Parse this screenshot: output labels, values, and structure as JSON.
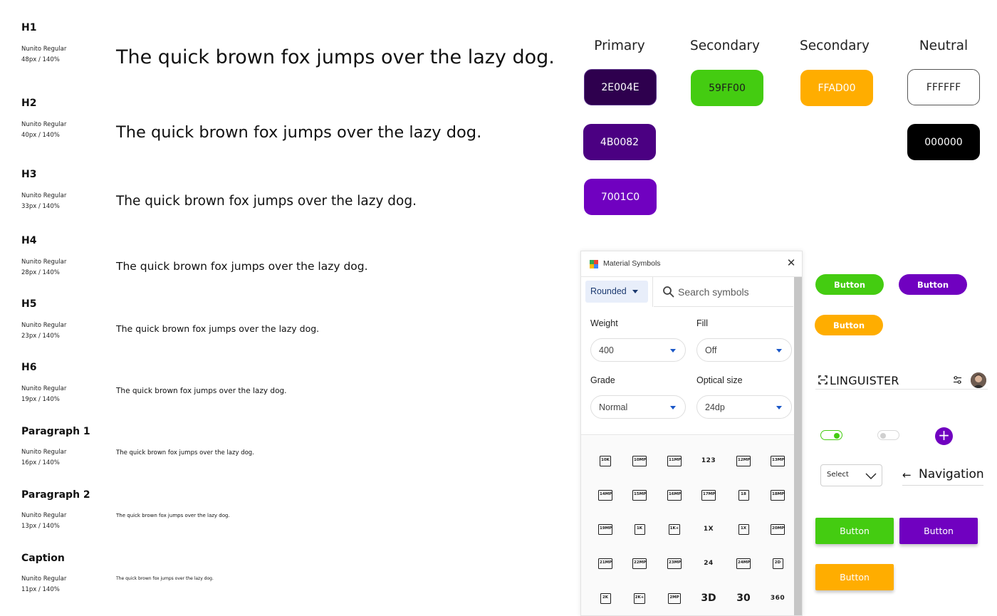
{
  "typography": {
    "sample_text": "The quick brown fox jumps over the lazy dog.",
    "styles": [
      {
        "name": "H1",
        "font": "Nunito Regular",
        "spec": "48px / 140%"
      },
      {
        "name": "H2",
        "font": "Nunito Regular",
        "spec": "40px / 140%"
      },
      {
        "name": "H3",
        "font": "Nunito Regular",
        "spec": "33px / 140%"
      },
      {
        "name": "H4",
        "font": "Nunito Regular",
        "spec": "28px / 140%"
      },
      {
        "name": "H5",
        "font": "Nunito Regular",
        "spec": "23px / 140%"
      },
      {
        "name": "H6",
        "font": "Nunito Regular",
        "spec": "19px / 140%"
      },
      {
        "name": "Paragraph 1",
        "font": "Nunito Regular",
        "spec": "16px / 140%"
      },
      {
        "name": "Paragraph 2",
        "font": "Nunito Regular",
        "spec": "13px / 140%"
      },
      {
        "name": "Caption",
        "font": "Nunito Regular",
        "spec": "11px / 140%"
      }
    ]
  },
  "palette": {
    "headers": [
      "Primary",
      "Secondary",
      "Secondary",
      "Neutral"
    ],
    "primary": [
      {
        "label": "2E004E",
        "color": "#2E004E"
      },
      {
        "label": "4B0082",
        "color": "#4B0082"
      },
      {
        "label": "7001C0",
        "color": "#7001C0"
      }
    ],
    "secondary_green": {
      "label": "59FF00",
      "color": "#59FF00"
    },
    "secondary_orange": {
      "label": "FFAD00",
      "color": "#FFAD00"
    },
    "neutral": [
      {
        "label": "FFFFFF",
        "color": "#FFFFFF"
      },
      {
        "label": "000000",
        "color": "#000000"
      }
    ]
  },
  "material_symbols": {
    "title": "Material Symbols",
    "style": "Rounded",
    "search_placeholder": "Search symbols",
    "weight": {
      "label": "Weight",
      "value": "400"
    },
    "fill": {
      "label": "Fill",
      "value": "Off"
    },
    "grade": {
      "label": "Grade",
      "value": "Normal"
    },
    "optical_size": {
      "label": "Optical size",
      "value": "24dp"
    },
    "glyphs": [
      [
        "10K",
        "10MP",
        "11MP",
        "123",
        "12MP",
        "13MP"
      ],
      [
        "14MP",
        "15MP",
        "16MP",
        "17MP",
        "18",
        "18MP"
      ],
      [
        "19MP",
        "1K",
        "1K+",
        "1X",
        "1X",
        "20MP"
      ],
      [
        "21MP",
        "22MP",
        "23MP",
        "24",
        "24MP",
        "2D"
      ],
      [
        "2K",
        "2K+",
        "2MP",
        "3D",
        "30",
        "360"
      ]
    ]
  },
  "components": {
    "pill_buttons": [
      {
        "label": "Button",
        "color": "#44CC11"
      },
      {
        "label": "Button",
        "color": "#7001C0"
      },
      {
        "label": "Button",
        "color": "#FFAD00"
      }
    ],
    "app_bar_title": "LINGUISTER",
    "toggle_on_color": "#44CC11",
    "select_label": "Select",
    "navigation_label": "Navigation",
    "navigation_arrow": "←",
    "fab_symbol": "+",
    "rect_buttons": [
      {
        "label": "Button",
        "color": "#44CC11"
      },
      {
        "label": "Button",
        "color": "#7001C0"
      },
      {
        "label": "Button",
        "color": "#FFAD00"
      }
    ]
  }
}
